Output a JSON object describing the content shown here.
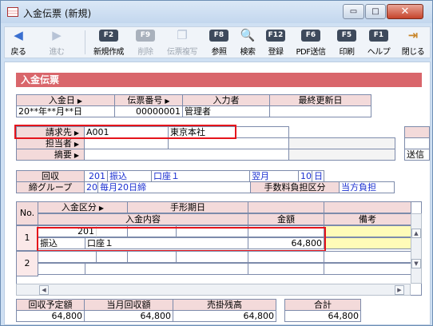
{
  "window": {
    "title": "入金伝票 (新規)",
    "min_glyph": "▭",
    "max_glyph": "□",
    "close_glyph": "✕"
  },
  "toolbar": {
    "items": [
      {
        "key": "",
        "icon": "back-arrow-icon",
        "glyph": "◀",
        "label": "戻る",
        "enabled": true
      },
      {
        "key": "",
        "icon": "forward-arrow-icon",
        "glyph": "▶",
        "label": "進む",
        "enabled": false
      },
      {
        "key": "F2",
        "label": "新規作成",
        "enabled": true
      },
      {
        "key": "F9",
        "label": "削除",
        "enabled": false
      },
      {
        "key": "",
        "icon": "copy-icon",
        "glyph": "❐",
        "label": "伝票複写",
        "enabled": false
      },
      {
        "key": "F8",
        "label": "参照",
        "enabled": true
      },
      {
        "key": "",
        "icon": "search-icon",
        "glyph": "🔍",
        "label": "検索",
        "enabled": true
      },
      {
        "key": "F12",
        "label": "登録",
        "enabled": true
      },
      {
        "key": "F6",
        "label": "PDF送信",
        "enabled": true
      },
      {
        "key": "F5",
        "label": "印刷",
        "enabled": true
      },
      {
        "key": "F1",
        "label": "ヘルプ",
        "enabled": true
      },
      {
        "key": "",
        "icon": "close-door-icon",
        "glyph": "⇥",
        "label": "閉じる",
        "enabled": true
      }
    ]
  },
  "form": {
    "title": "入金伝票",
    "header": {
      "date_label": "入金日",
      "date_value": "20**年**月**日",
      "slip_label": "伝票番号",
      "slip_value": "00000001",
      "inputter_label": "入力者",
      "inputter_value": "管理者",
      "updated_label": "最終更新日",
      "updated_value": ""
    },
    "billing": {
      "label": "請求先",
      "code": "A001",
      "name": "東京本社"
    },
    "person": {
      "label": "担当者"
    },
    "summary": {
      "label": "摘要"
    },
    "right_partial": {
      "send_label": "送信"
    },
    "collection": {
      "label": "回収",
      "code": "201",
      "method": "振込",
      "account": "口座１",
      "month": "翌月",
      "day": "10",
      "day_unit": "日"
    },
    "closing": {
      "label": "締グループ",
      "code": "20",
      "name": "毎月20日締",
      "fee_label": "手数料負担区分",
      "fee_value": "当方負担"
    },
    "detail": {
      "no_label": "No.",
      "kubun_label": "入金区分",
      "tegata_label": "手形期日",
      "content_label": "入金内容",
      "amount_label": "金額",
      "memo_label": "備考",
      "rows": [
        {
          "no": "1",
          "code": "201",
          "kind": "振込",
          "account": "口座１",
          "amount": "64,800"
        },
        {
          "no": "2",
          "code": "",
          "kind": "",
          "account": "",
          "amount": ""
        }
      ]
    },
    "totals": {
      "planned_label": "回収予定額",
      "planned_value": "64,800",
      "month_label": "当月回収額",
      "month_value": "64,800",
      "receivable_label": "売掛残高",
      "receivable_value": "64,800",
      "total_label": "合計",
      "total_value": "64,800"
    }
  },
  "colors": {
    "header_bar": "#d9666b",
    "label_bg": "#f3dada",
    "highlight": "#e5141c",
    "memo_yellow": "#fffbb8"
  }
}
